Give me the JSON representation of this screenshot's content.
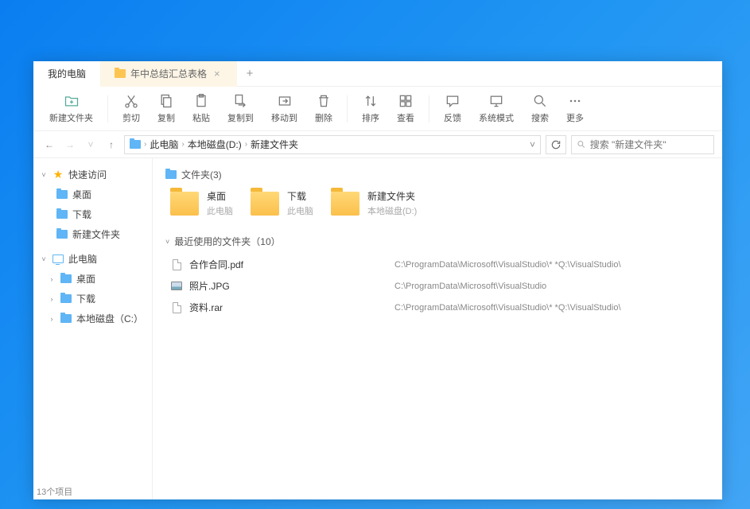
{
  "tabs": {
    "active": "我的电脑",
    "inactive": "年中总结汇总表格"
  },
  "toolbar": {
    "new_folder": "新建文件夹",
    "cut": "剪切",
    "copy": "复制",
    "paste": "粘贴",
    "copy_to": "复制到",
    "move_to": "移动到",
    "delete": "删除",
    "sort": "排序",
    "view": "查看",
    "feedback": "反馈",
    "system_mode": "系统模式",
    "search": "搜索",
    "more": "更多"
  },
  "breadcrumb": {
    "seg1": "此电脑",
    "seg2": "本地磁盘(D:)",
    "seg3": "新建文件夹"
  },
  "search_placeholder": "搜索 \"新建文件夹\"",
  "sidebar": {
    "quick": "快速访问",
    "desktop": "桌面",
    "download": "下载",
    "newfolder": "新建文件夹",
    "thispc": "此电脑",
    "desktop2": "桌面",
    "download2": "下载",
    "localdisk": "本地磁盘（C:）"
  },
  "sections": {
    "folders_hdr": "文件夹(3)",
    "recent_hdr": "最近使用的文件夹（10）"
  },
  "folders": [
    {
      "name": "桌面",
      "sub": "此电脑"
    },
    {
      "name": "下载",
      "sub": "此电脑"
    },
    {
      "name": "新建文件夹",
      "sub": "本地磁盘(D:)"
    }
  ],
  "files": [
    {
      "name": "合作合同.pdf",
      "type": "doc",
      "path": "C:\\ProgramData\\Microsoft\\VisualStudio\\* *Q:\\VisualStudio\\"
    },
    {
      "name": "照片.JPG",
      "type": "img",
      "path": "C:\\ProgramData\\Microsoft\\VisualStudio"
    },
    {
      "name": "资料.rar",
      "type": "doc",
      "path": "C:\\ProgramData\\Microsoft\\VisualStudio\\* *Q:\\VisualStudio\\"
    }
  ],
  "status": "13个项目"
}
